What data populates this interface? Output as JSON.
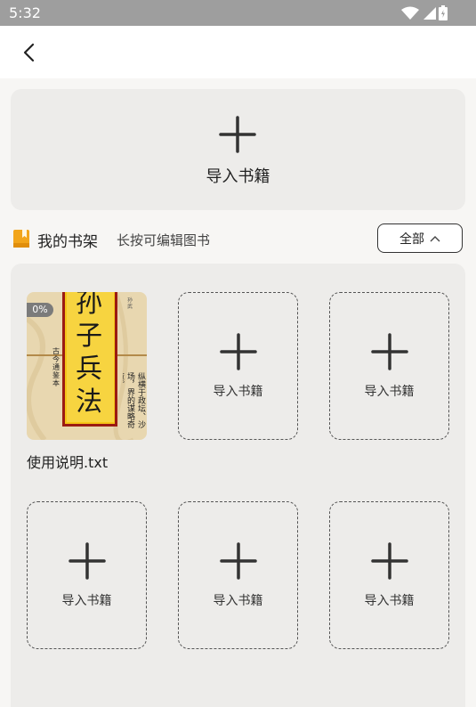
{
  "status_bar": {
    "time": "5:32"
  },
  "import_card": {
    "label": "导入书籍"
  },
  "shelf": {
    "title": "我的书架",
    "hint": "长按可编辑图书",
    "filter_label": "全部",
    "books": [
      {
        "title": "使用说明.txt",
        "progress": "0%",
        "cover_title": [
          "孙",
          "子",
          "兵",
          "法"
        ],
        "cover_subtitle": "古今通鉴本",
        "cover_author": "孙武",
        "cover_tagline": "纵横于政坛、沙场，界的谋略奇策。"
      }
    ],
    "empty_slots": [
      {
        "label": "导入书籍"
      },
      {
        "label": "导入书籍"
      },
      {
        "label": "导入书籍"
      },
      {
        "label": "导入书籍"
      },
      {
        "label": "导入书籍"
      }
    ]
  }
}
